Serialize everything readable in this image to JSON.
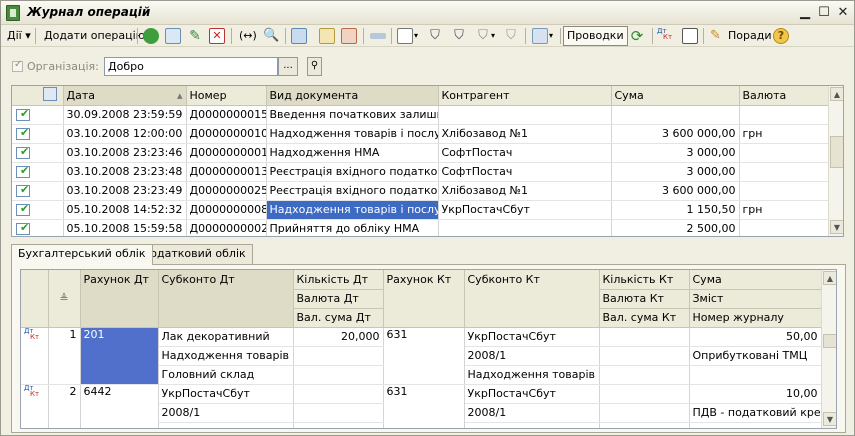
{
  "window": {
    "title": "Журнал операцій"
  },
  "toolbar": {
    "actions_label": "Дії",
    "add_operation_label": "Додати операцію",
    "postings_label": "Проводки",
    "tips_label": "Поради"
  },
  "filter": {
    "label": "Організація:",
    "value": "Добро",
    "ellipsis": "...",
    "dt": "Дт",
    "kt": "Кт"
  },
  "journal": {
    "columns": [
      "Дата",
      "Номер",
      "Вид документа",
      "Контрагент",
      "Сума",
      "Валюта"
    ],
    "rows": [
      {
        "date": "30.09.2008 23:59:59",
        "number": "Д0000000015",
        "doc_type": "Введення початкових залишків",
        "counterparty": "",
        "sum": "",
        "currency": ""
      },
      {
        "date": "03.10.2008 12:00:00",
        "number": "Д0000000010",
        "doc_type": "Надходження товарів і послуг",
        "counterparty": "Хлібозавод №1",
        "sum": "3 600 000,00",
        "currency": "грн"
      },
      {
        "date": "03.10.2008 23:23:46",
        "number": "Д0000000001",
        "doc_type": "Надходження НМА",
        "counterparty": "СофтПостач",
        "sum": "3 000,00",
        "currency": ""
      },
      {
        "date": "03.10.2008 23:23:48",
        "number": "Д0000000013",
        "doc_type": "Реєстрація вхідного податков...",
        "counterparty": "СофтПостач",
        "sum": "3 000,00",
        "currency": ""
      },
      {
        "date": "03.10.2008 23:23:49",
        "number": "Д0000000025",
        "doc_type": "Реєстрація вхідного податков...",
        "counterparty": "Хлібозавод №1",
        "sum": "3 600 000,00",
        "currency": ""
      },
      {
        "date": "05.10.2008 14:52:32",
        "number": "Д0000000008",
        "doc_type": "Надходження товарів і послуг",
        "counterparty": "УкрПостачСбут",
        "sum": "1 150,50",
        "currency": "грн"
      },
      {
        "date": "05.10.2008 15:59:58",
        "number": "Д0000000002",
        "doc_type": "Прийняття до обліку НМА",
        "counterparty": "",
        "sum": "2 500,00",
        "currency": ""
      }
    ]
  },
  "tabs": [
    {
      "label": "Бухгалтерський облік"
    },
    {
      "label": "Податковий облік"
    }
  ],
  "postings": {
    "headers": {
      "account_dt": "Рахунок Дт",
      "subconto_dt": "Субконто Дт",
      "qty_dt": "Кількість Дт",
      "currency_dt": "Валюта Дт",
      "cur_sum_dt": "Вал. сума Дт",
      "account_kt": "Рахунок Кт",
      "subconto_kt": "Субконто Кт",
      "qty_kt": "Кількість Кт",
      "currency_kt": "Валюта Кт",
      "cur_sum_kt": "Вал. сума Кт",
      "sum": "Сума",
      "content": "Зміст",
      "journal_no": "Номер журналу"
    },
    "rows": [
      {
        "n": "1",
        "account_dt": "201",
        "subconto_dt": [
          "Лак декоративний",
          "Надходження товарів і ...",
          "Головний склад"
        ],
        "qty_dt": "20,000",
        "account_kt": "631",
        "subconto_kt": [
          "УкрПостачСбут",
          "2008/1",
          "Надходження товарів і ..."
        ],
        "sum": "50,00",
        "content": "Оприбутковані ТМЦ"
      },
      {
        "n": "2",
        "account_dt": "6442",
        "subconto_dt": [
          "УкрПостачСбут",
          "2008/1"
        ],
        "qty_dt": "",
        "account_kt": "631",
        "subconto_kt": [
          "УкрПостачСбут",
          "2008/1"
        ],
        "sum": "10,00",
        "content": "ПДВ - податковий кре..."
      }
    ]
  }
}
